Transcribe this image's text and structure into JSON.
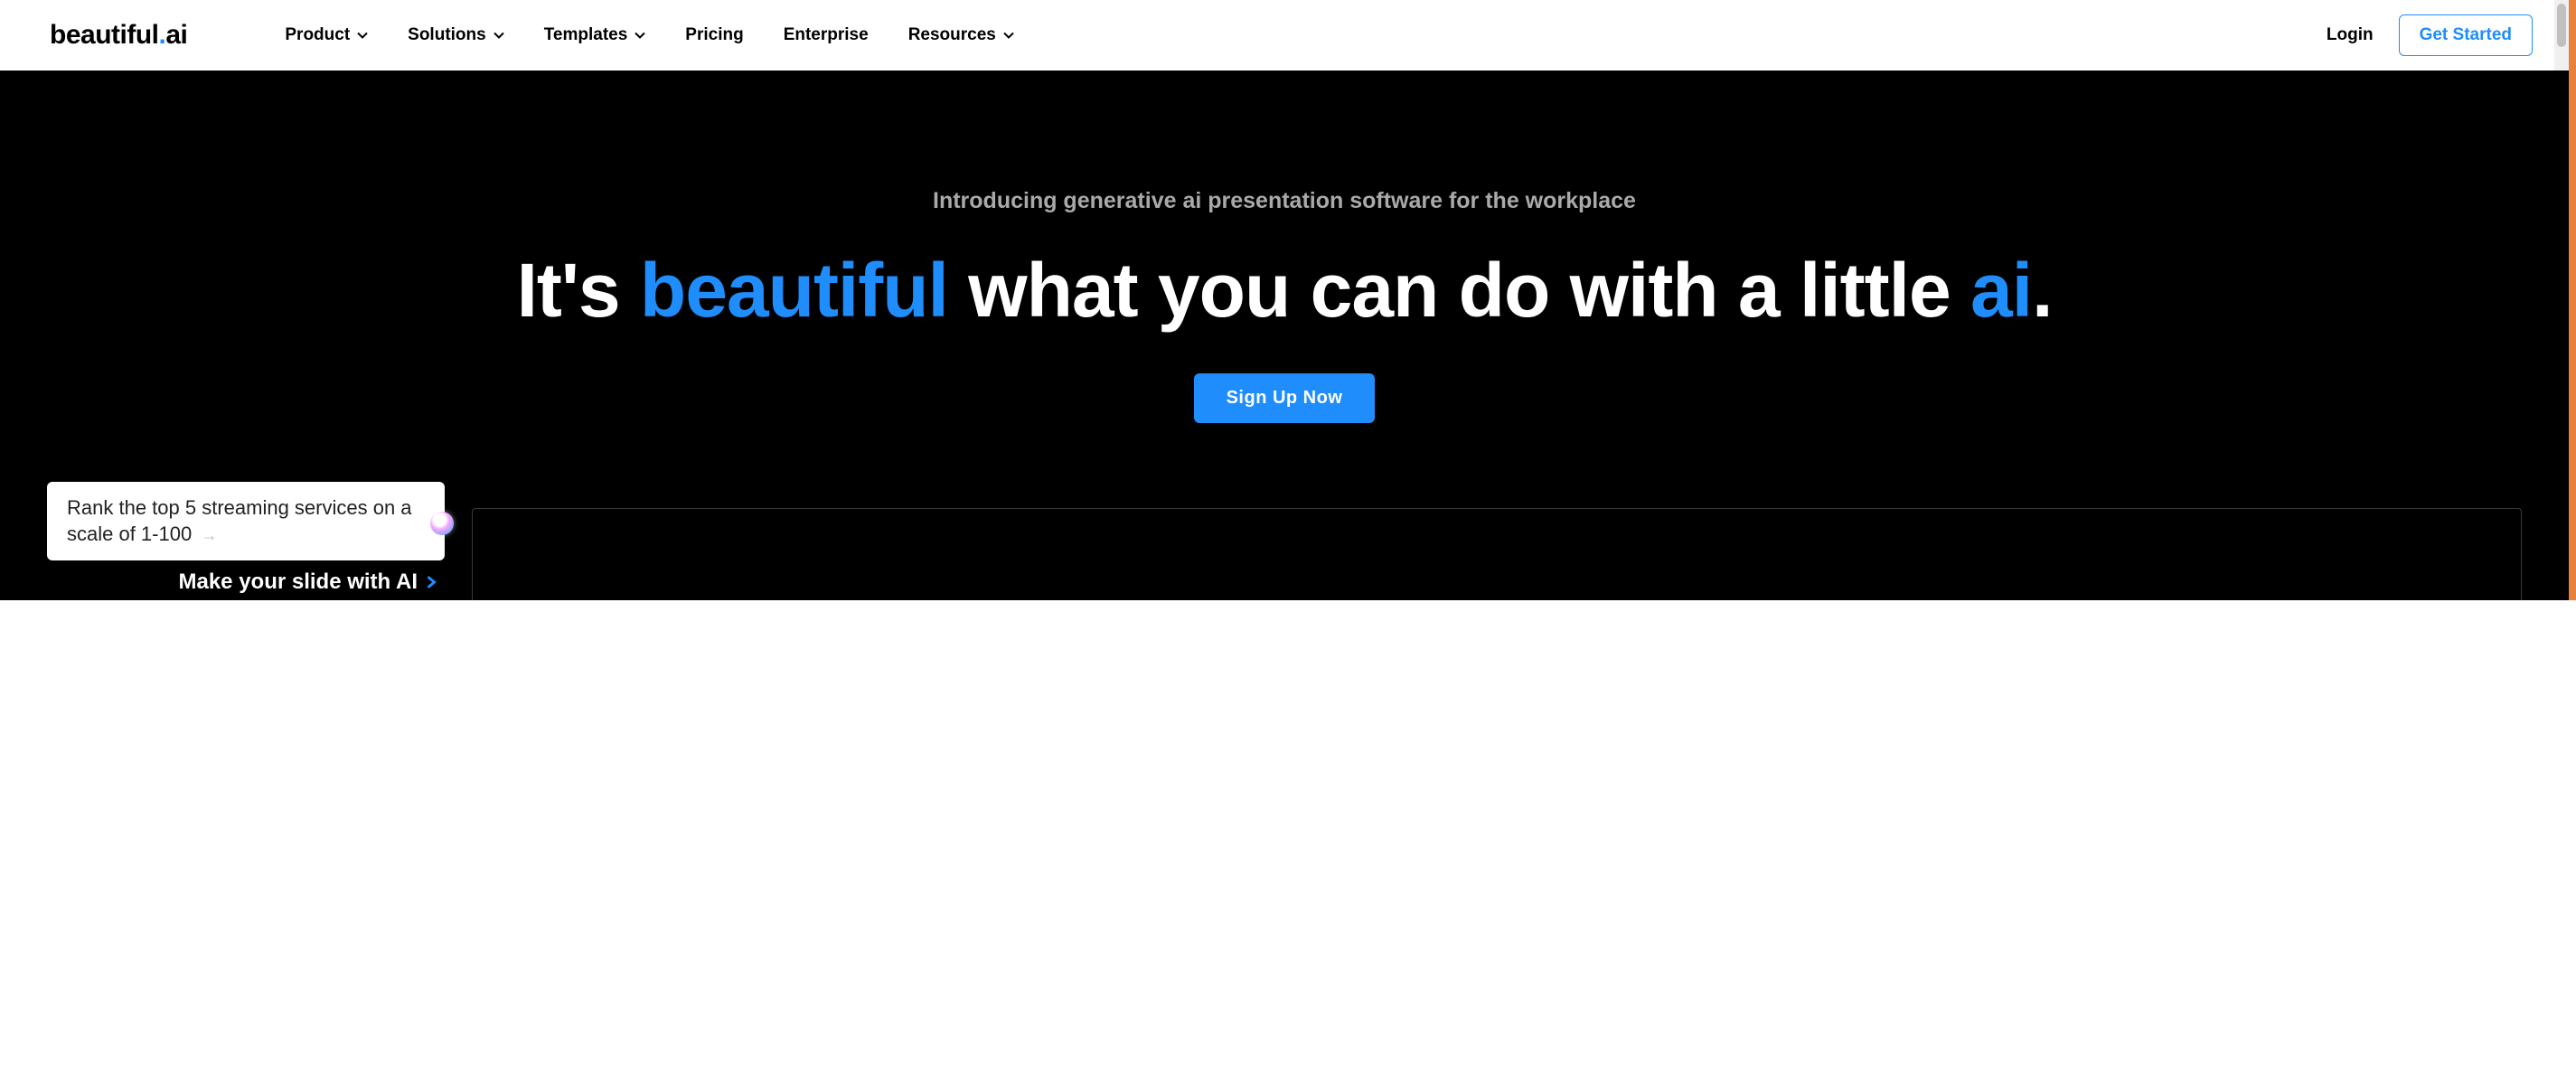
{
  "logo": {
    "text_before": "beautiful",
    "dot": ".",
    "text_after": "ai"
  },
  "nav": {
    "items": [
      {
        "label": "Product",
        "has_dropdown": true
      },
      {
        "label": "Solutions",
        "has_dropdown": true
      },
      {
        "label": "Templates",
        "has_dropdown": true
      },
      {
        "label": "Pricing",
        "has_dropdown": false
      },
      {
        "label": "Enterprise",
        "has_dropdown": false
      },
      {
        "label": "Resources",
        "has_dropdown": true
      }
    ]
  },
  "header_actions": {
    "login_label": "Login",
    "get_started_label": "Get Started"
  },
  "hero": {
    "subtitle": "Introducing generative ai presentation software for the workplace",
    "title_part1": "It's ",
    "title_accent1": "beautiful",
    "title_part2": " what you can do with a little ",
    "title_accent2": "ai",
    "title_part3": ".",
    "signup_label": "Sign Up Now"
  },
  "prompt": {
    "text": "Rank the top 5 streaming services on a scale of 1-100",
    "make_slide_label": "Make your slide with AI"
  },
  "colors": {
    "accent": "#1F8DFB",
    "background_dark": "#000000",
    "background_light": "#ffffff"
  }
}
